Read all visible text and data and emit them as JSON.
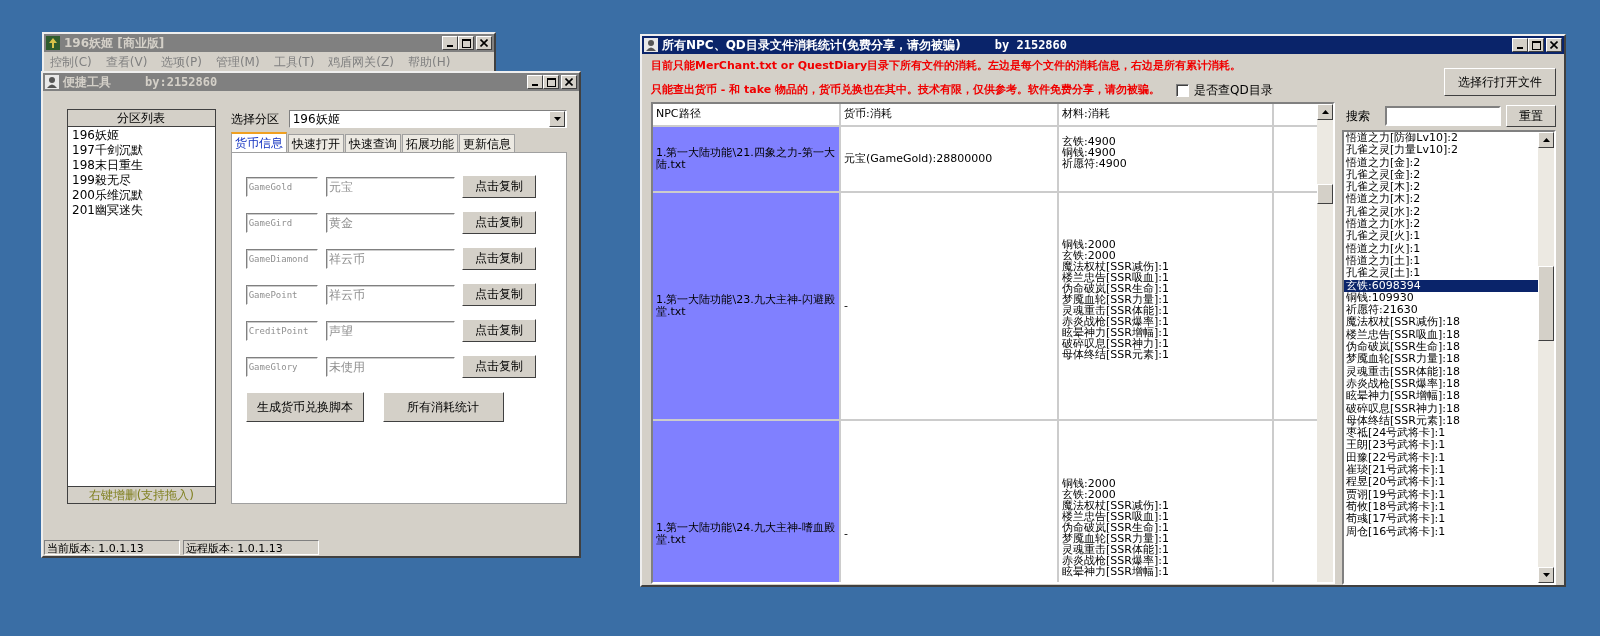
{
  "main_window": {
    "title": "196妖姬 [商业版]",
    "menu": [
      "控制(C)",
      "查看(V)",
      "选项(P)",
      "管理(M)",
      "工具(T)",
      "鸡盾网关(Z)",
      "帮助(H)"
    ]
  },
  "tool_window": {
    "title": "便捷工具",
    "author": "by:2152860",
    "zone_list": {
      "header": "分区列表",
      "items": [
        "196妖姬",
        "197千剑沉默",
        "198末日重生",
        "199殺无尽",
        "200乐维沉默",
        "201幽冥迷失"
      ],
      "footer": "右键增删(支持拖入)"
    },
    "zone_select": {
      "label": "选择分区",
      "value": "196妖姬"
    },
    "tabs": [
      {
        "label": "货币信息",
        "selected": true
      },
      {
        "label": "快速打开",
        "selected": false
      },
      {
        "label": "快速查询",
        "selected": false
      },
      {
        "label": "拓展功能",
        "selected": false
      },
      {
        "label": "更新信息",
        "selected": false
      }
    ],
    "currency_rows": [
      {
        "code": "GameGold",
        "name": "元宝",
        "button": "点击复制"
      },
      {
        "code": "GameGird",
        "name": "黄金",
        "button": "点击复制"
      },
      {
        "code": "GameDiamond",
        "name": "祥云币",
        "button": "点击复制"
      },
      {
        "code": "GamePoint",
        "name": "祥云币",
        "button": "点击复制"
      },
      {
        "code": "CreditPoint",
        "name": "声望",
        "button": "点击复制"
      },
      {
        "code": "GameGlory",
        "name": "未使用",
        "button": "点击复制"
      }
    ],
    "actions": [
      "生成货币兑换脚本",
      "所有消耗统计"
    ],
    "status_bar": [
      "当前版本: 1.0.1.13",
      "远程版本: 1.0.1.13"
    ]
  },
  "stats_window": {
    "title": "所有NPC、QD目录文件消耗统计(免费分享，请勿被骗)",
    "author": "by 2152860",
    "notices": [
      "目前只能MerChant.txt or QuestDiary目录下所有文件的消耗。左边是每个文件的消耗信息，右边是所有累计消耗。",
      "只能查出货币 - 和 take 物品的，货币兑换也在其中。技术有限，仅供参考。软件免费分享，请勿被骗。"
    ],
    "qd_checkbox": {
      "label": "是否查QD目录",
      "checked": false
    },
    "open_button": "选择行打开文件",
    "table": {
      "columns": [
        "NPC路径",
        "货币:消耗",
        "材料:消耗"
      ],
      "rows": [
        {
          "path": "1.第一大陆功能\\21.四象之力-第一大陆.txt",
          "currency": "元宝(GameGold):28800000",
          "materials": [
            "玄铁:4900",
            "铜钱:4900",
            "祈愿符:4900"
          ]
        },
        {
          "path": "1.第一大陆功能\\23.九大主神-闪避殿堂.txt",
          "currency": "-",
          "materials": [
            "铜钱:2000",
            "玄铁:2000",
            "魔法权杖[SSR减伤]:1",
            "楼兰忠告[SSR吸血]:1",
            "伪命破岚[SSR生命]:1",
            "梦魇血轮[SSR力量]:1",
            "灵魂重击[SSR体能]:1",
            "赤炎战枪[SSR爆率]:1",
            "眩晕神力[SSR增幅]:1",
            "破碎叹息[SSR神力]:1",
            "母体终结[SSR元素]:1"
          ]
        },
        {
          "path": "1.第一大陆功能\\24.九大主神-嗜血殿堂.txt",
          "currency": "-",
          "materials": [
            "铜钱:2000",
            "玄铁:2000",
            "魔法权杖[SSR减伤]:1",
            "楼兰忠告[SSR吸血]:1",
            "伪命破岚[SSR生命]:1",
            "梦魇血轮[SSR力量]:1",
            "灵魂重击[SSR体能]:1",
            "赤炎战枪[SSR爆率]:1",
            "眩晕神力[SSR增幅]:1"
          ]
        }
      ]
    },
    "search": {
      "label": "搜索",
      "button": "重置"
    },
    "totals": [
      {
        "text": "悟道之力[防御Lv10]:2",
        "selected": false
      },
      {
        "text": "孔雀之灵[力量Lv10]:2",
        "selected": false
      },
      {
        "text": "悟道之力[金]:2",
        "selected": false
      },
      {
        "text": "孔雀之灵[金]:2",
        "selected": false
      },
      {
        "text": "孔雀之灵[木]:2",
        "selected": false
      },
      {
        "text": "悟道之力[木]:2",
        "selected": false
      },
      {
        "text": "孔雀之灵[水]:2",
        "selected": false
      },
      {
        "text": "悟道之力[水]:2",
        "selected": false
      },
      {
        "text": "孔雀之灵[火]:1",
        "selected": false
      },
      {
        "text": "悟道之力[火]:1",
        "selected": false
      },
      {
        "text": "悟道之力[土]:1",
        "selected": false
      },
      {
        "text": "孔雀之灵[土]:1",
        "selected": false
      },
      {
        "text": "玄铁:6098394",
        "selected": true
      },
      {
        "text": "铜钱:109930",
        "selected": false
      },
      {
        "text": "祈愿符:21630",
        "selected": false
      },
      {
        "text": "魔法权杖[SSR减伤]:18",
        "selected": false
      },
      {
        "text": "楼兰忠告[SSR吸血]:18",
        "selected": false
      },
      {
        "text": "伪命破岚[SSR生命]:18",
        "selected": false
      },
      {
        "text": "梦魇血轮[SSR力量]:18",
        "selected": false
      },
      {
        "text": "灵魂重击[SSR体能]:18",
        "selected": false
      },
      {
        "text": "赤炎战枪[SSR爆率]:18",
        "selected": false
      },
      {
        "text": "眩晕神力[SSR增幅]:18",
        "selected": false
      },
      {
        "text": "破碎叹息[SSR神力]:18",
        "selected": false
      },
      {
        "text": "母体终结[SSR元素]:18",
        "selected": false
      },
      {
        "text": "枣祗[24号武将卡]:1",
        "selected": false
      },
      {
        "text": "王朗[23号武将卡]:1",
        "selected": false
      },
      {
        "text": "田豫[22号武将卡]:1",
        "selected": false
      },
      {
        "text": "崔琰[21号武将卡]:1",
        "selected": false
      },
      {
        "text": "程昱[20号武将卡]:1",
        "selected": false
      },
      {
        "text": "贾诩[19号武将卡]:1",
        "selected": false
      },
      {
        "text": "荀攸[18号武将卡]:1",
        "selected": false
      },
      {
        "text": "荀彧[17号武将卡]:1",
        "selected": false
      },
      {
        "text": "周仓[16号武将卡]:1",
        "selected": false
      }
    ]
  }
}
